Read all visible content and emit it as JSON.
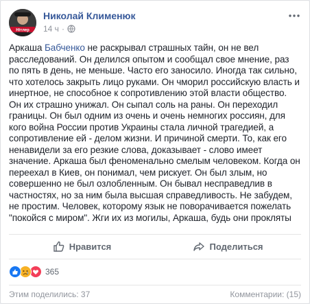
{
  "post": {
    "author": "Николай Клименюк",
    "time": "14 ч",
    "avatar_text": "Нітлер",
    "text_before_mention": "Аркаша ",
    "mention": "Бабченко",
    "text_after_mention": " не раскрывал страшных тайн, он не вел расследований. Он делился опытом и сообщал свое мнение, раз по пять в день, не меньше. Часто его заносило. Иногда так сильно, что хотелось закрыть лицо руками. Он чморил российскую власть и инертное, не способное к сопротивлению этой власти общество. Он их страшно унижал. Он сыпал соль на раны. Он переходил границы. Он был одним из очень и очень немногих россиян, для кого война России против Украины стала личной трагедией, а сопротивление ей - делом жизни. И причиной смерти. То, как его ненавидели за его резкие слова, доказывает - слово имеет значение. Аркаша был феноменально смелым человеком. Когда он переехал в Киев, он понимал, чем рискует. Он был злым, но совершенно не был озлобленным. Он бывал несправедлив в частностях, но за ним была высшая справедливость. Не забудем, не простим. Человек, которому язык не поворачивается пожелать \"покойся с миром\". Жги их из могилы, Аркаша, будь они прокляты"
  },
  "actions": {
    "like_label": "Нравится",
    "share_label": "Поделиться"
  },
  "reactions": {
    "count": "365",
    "icons": [
      "like-reaction",
      "sad-reaction",
      "love-reaction"
    ]
  },
  "footer": {
    "shares": "Этим поделились: 37",
    "comments": "Комментарии: (15)"
  },
  "colors": {
    "link": "#365899",
    "text": "#1d2129",
    "muted": "#90949c",
    "like_blue": "#1877f2",
    "love_red": "#f33e58",
    "sad_yellow": "#f7b125"
  }
}
